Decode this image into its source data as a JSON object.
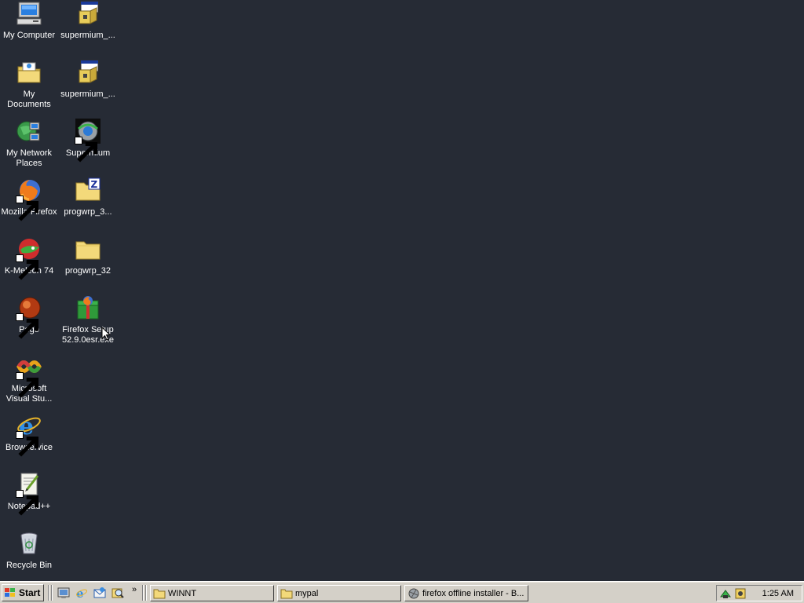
{
  "desktop": {
    "icons": [
      {
        "label": "My Computer",
        "icon": "my-computer-icon"
      },
      {
        "label": "supermium_...",
        "icon": "installer-icon"
      },
      {
        "label": "My Documents",
        "icon": "my-documents-icon"
      },
      {
        "label": "supermium_...",
        "icon": "installer-icon"
      },
      {
        "label": "My Network Places",
        "icon": "network-places-icon"
      },
      {
        "label": "Supermium",
        "icon": "supermium-icon"
      },
      {
        "label": "Mozilla Firefox",
        "icon": "firefox-icon"
      },
      {
        "label": "progwrp_3...",
        "icon": "zip-folder-icon"
      },
      {
        "label": "K-Meleon 74",
        "icon": "kmeleon-icon"
      },
      {
        "label": "progwrp_32",
        "icon": "folder-icon"
      },
      {
        "label": "Pego",
        "icon": "pego-icon"
      },
      {
        "label": "Firefox Setup 52.9.0esr.exe",
        "icon": "firefox-setup-icon"
      },
      {
        "label": "Microsoft Visual Stu...",
        "icon": "visual-studio-icon"
      },
      {
        "label": "Browservice",
        "icon": "internet-explorer-icon"
      },
      {
        "label": "Notepad++",
        "icon": "notepadpp-icon"
      },
      {
        "label": "Recycle Bin",
        "icon": "recycle-bin-icon"
      }
    ]
  },
  "taskbar": {
    "start_label": "Start",
    "quick_launch_more": "»",
    "tasks": [
      {
        "label": "WINNT",
        "icon": "folder-icon"
      },
      {
        "label": "mypal",
        "icon": "folder-icon"
      },
      {
        "label": "firefox offline installer - B...",
        "icon": "browser-window-icon"
      }
    ],
    "clock": "1:25 AM"
  },
  "colors": {
    "desktop_bg": "#262b35",
    "taskbar_bg": "#d4d0c8"
  }
}
